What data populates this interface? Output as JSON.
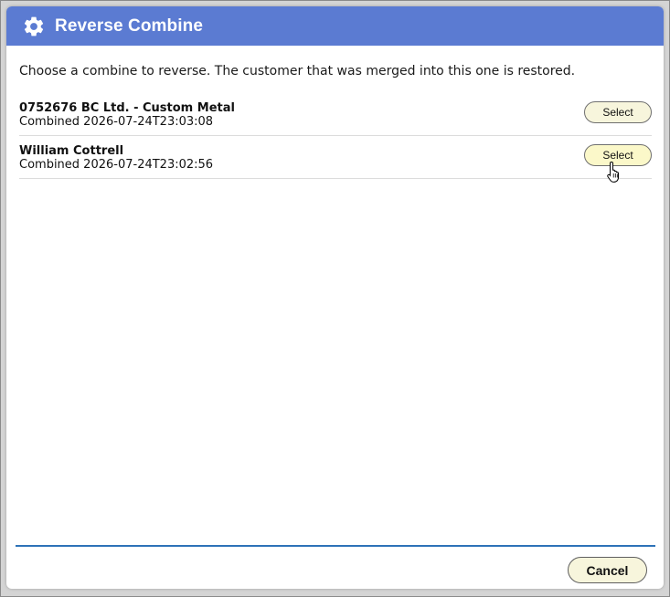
{
  "dialog": {
    "title": "Reverse Combine",
    "title_icon": "gear-icon",
    "instructions": "Choose a combine to reverse. The customer that was merged into this one is restored.",
    "combines": [
      {
        "name": "0752676 BC Ltd. - Custom Metal",
        "combined": "Combined 2026-07-24T23:03:08",
        "select_label": "Select"
      },
      {
        "name": "William Cottrell",
        "combined": "Combined 2026-07-24T23:02:56",
        "select_label": "Select"
      }
    ],
    "cancel_label": "Cancel"
  },
  "colors": {
    "title_bar": "#5b7bd2",
    "button_fill": "#f7f5dc",
    "footer_rule": "#2e72b8"
  }
}
